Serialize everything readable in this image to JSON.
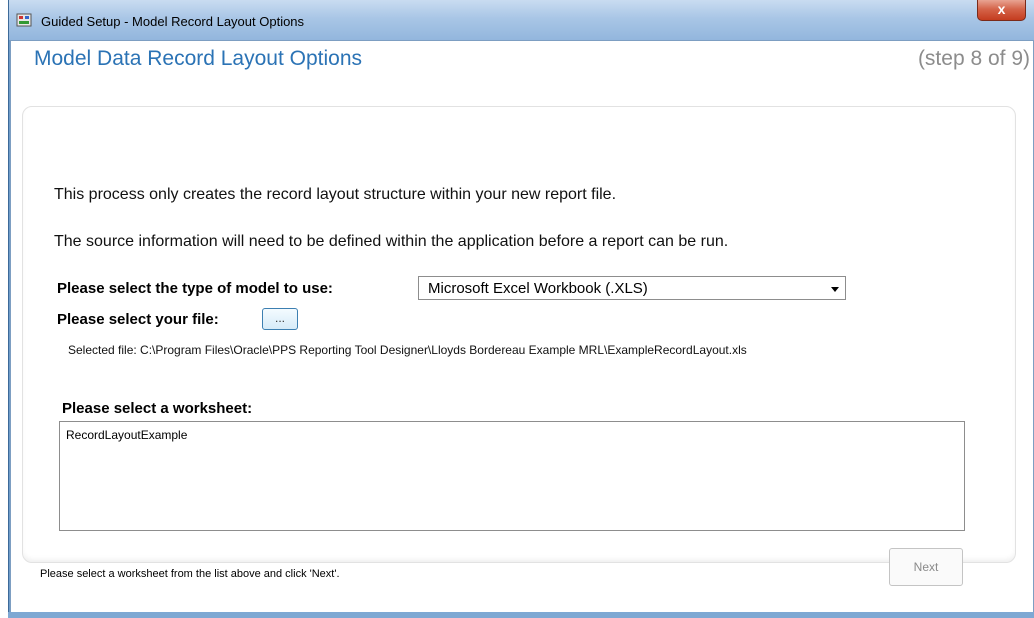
{
  "window": {
    "title": "Guided Setup - Model Record Layout Options",
    "close_label": "x"
  },
  "header": {
    "title": "Model Data Record Layout Options",
    "step": "(step 8 of 9)"
  },
  "main": {
    "info_line1": "This process only creates the record layout structure within your new report file.",
    "info_line2": "The source information will need to be defined within the application before a report can be run.",
    "model_label": "Please select the type of model to use:",
    "model_selected": "Microsoft Excel Workbook (.XLS)",
    "file_label": "Please select your file:",
    "browse_label": "...",
    "selected_file": "Selected file: C:\\Program Files\\Oracle\\PPS Reporting Tool Designer\\Lloyds Bordereau Example MRL\\ExampleRecordLayout.xls",
    "worksheet_label": "Please select a worksheet:",
    "worksheets": [
      "RecordLayoutExample"
    ]
  },
  "footer": {
    "hint": "Please select a worksheet from the list above and click 'Next'.",
    "next_label": "Next"
  }
}
